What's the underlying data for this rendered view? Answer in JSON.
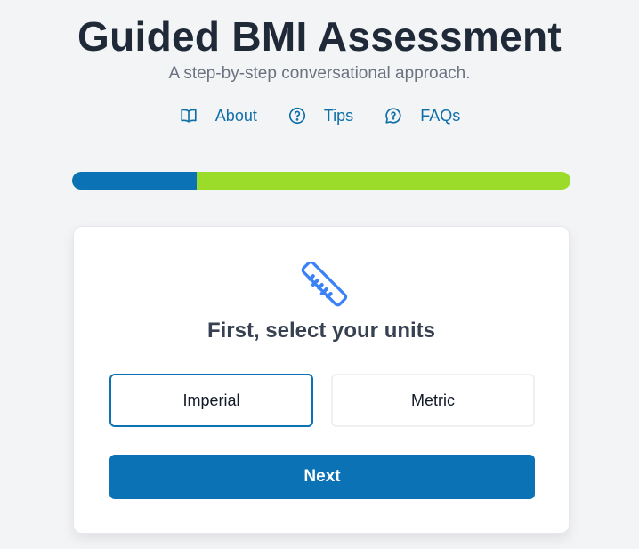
{
  "header": {
    "title": "Guided BMI Assessment",
    "subtitle": "A step-by-step conversational approach."
  },
  "nav": {
    "items": [
      {
        "label": "About",
        "icon": "book-icon"
      },
      {
        "label": "Tips",
        "icon": "question-circle-icon"
      },
      {
        "label": "FAQs",
        "icon": "question-chat-icon"
      }
    ]
  },
  "progress": {
    "fraction": 0.25
  },
  "card": {
    "icon": "ruler-icon",
    "heading": "First, select your units",
    "options": [
      {
        "label": "Imperial",
        "selected": true
      },
      {
        "label": "Metric",
        "selected": false
      }
    ],
    "next_label": "Next"
  },
  "colors": {
    "accent": "#0b72b5",
    "progress_track": "#9bdc2a",
    "link": "#0e6fa8",
    "icon_blue": "#3b82f6",
    "background": "#f3f4f6"
  }
}
